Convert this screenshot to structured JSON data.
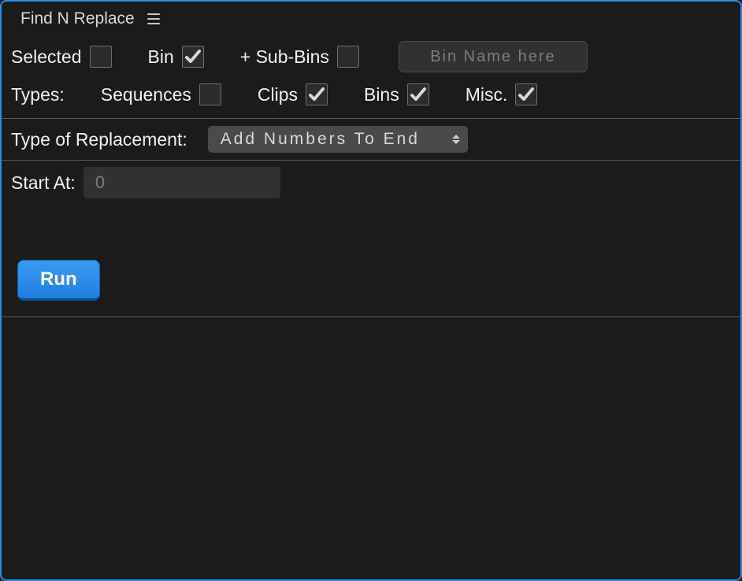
{
  "title": "Find N Replace",
  "scope": {
    "selected_label": "Selected",
    "selected_checked": false,
    "bin_label": "Bin",
    "bin_checked": true,
    "subbins_label": "+ Sub-Bins",
    "subbins_checked": false,
    "bin_name_value": "",
    "bin_name_placeholder": "Bin Name here"
  },
  "types": {
    "label": "Types:",
    "sequences_label": "Sequences",
    "sequences_checked": false,
    "clips_label": "Clips",
    "clips_checked": true,
    "bins_label": "Bins",
    "bins_checked": true,
    "misc_label": "Misc.",
    "misc_checked": true
  },
  "replacement": {
    "label": "Type of Replacement:",
    "selected": "Add Numbers To End"
  },
  "start": {
    "label": "Start At:",
    "value": "",
    "placeholder": "0"
  },
  "run_label": "Run"
}
